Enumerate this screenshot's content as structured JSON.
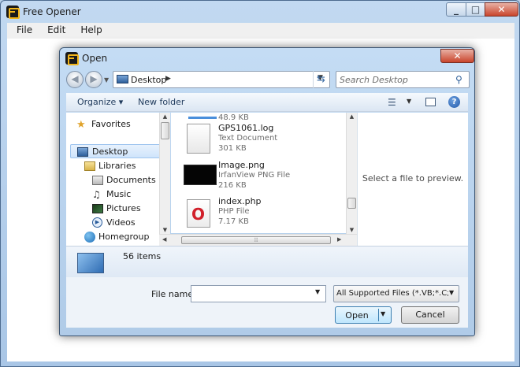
{
  "window": {
    "title": "Free Opener",
    "menu": [
      "File",
      "Edit",
      "Help"
    ]
  },
  "dialog": {
    "title": "Open",
    "address": "Desktop",
    "search_placeholder": "Search Desktop",
    "toolbar": {
      "organize": "Organize ▾",
      "new_folder": "New folder"
    },
    "nav": [
      {
        "label": "Favorites",
        "icon": "star-icon"
      },
      {
        "label": "Desktop",
        "icon": "desktop-icon",
        "selected": true
      },
      {
        "label": "Libraries",
        "icon": "library-icon"
      },
      {
        "label": "Documents",
        "icon": "documents-icon"
      },
      {
        "label": "Music",
        "icon": "music-icon"
      },
      {
        "label": "Pictures",
        "icon": "pictures-icon"
      },
      {
        "label": "Videos",
        "icon": "videos-icon"
      },
      {
        "label": "Homegroup",
        "icon": "homegroup-icon"
      }
    ],
    "files": [
      {
        "name": "",
        "type": "",
        "size": "48.9 KB",
        "icon": "folder-icon"
      },
      {
        "name": "GPS1061.log",
        "type": "Text Document",
        "size": "301 KB",
        "icon": "text-document-icon"
      },
      {
        "name": "Image.png",
        "type": "IrfanView PNG File",
        "size": "216 KB",
        "icon": "image-thumbnail-icon"
      },
      {
        "name": "index.php",
        "type": "PHP File",
        "size": "7.17 KB",
        "icon": "opera-icon"
      }
    ],
    "preview_text": "Select a file to preview.",
    "details_count": "56 items",
    "file_name_label": "File name:",
    "file_name_value": "",
    "filter": "All Supported Files (*.VB;*.C;*.C",
    "open_label": "Open",
    "cancel_label": "Cancel"
  }
}
